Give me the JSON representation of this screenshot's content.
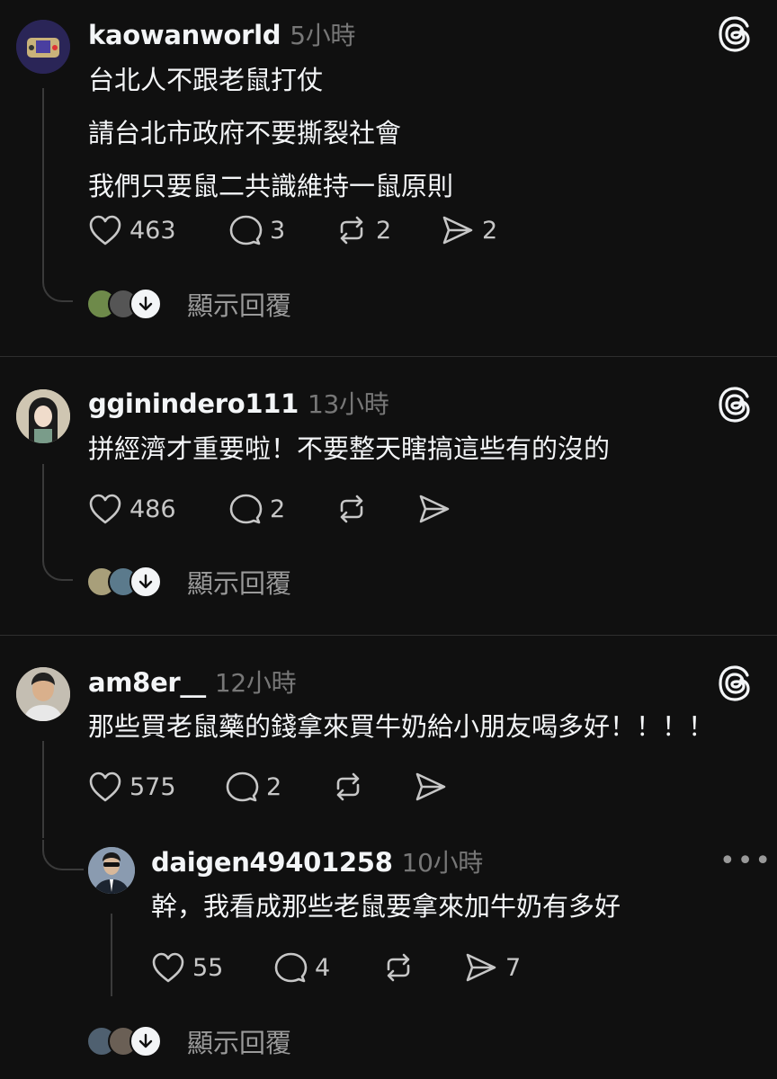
{
  "posts": [
    {
      "username": "kaowanworld",
      "time": "5小時",
      "lines": [
        "台北人不跟老鼠打仗",
        "請台北市政府不要撕裂社會",
        "我們只要鼠二共識維持一鼠原則"
      ],
      "likes": "463",
      "comments": "3",
      "reposts": "2",
      "shares": "2",
      "show_replies": "顯示回覆"
    },
    {
      "username": "gginindero111",
      "time": "13小時",
      "lines": [
        "拼經濟才重要啦！不要整天瞎搞這些有的沒的"
      ],
      "likes": "486",
      "comments": "2",
      "reposts": "",
      "shares": "",
      "show_replies": "顯示回覆"
    },
    {
      "username": "am8er__",
      "time": "12小時",
      "lines": [
        "那些買老鼠藥的錢拿來買牛奶給小朋友喝多好！！！！"
      ],
      "likes": "575",
      "comments": "2",
      "reposts": "",
      "shares": ""
    }
  ],
  "reply": {
    "username": "daigen49401258",
    "time": "10小時",
    "text": "幹，我看成那些老鼠要拿來加牛奶有多好",
    "likes": "55",
    "comments": "4",
    "reposts": "",
    "shares": "7",
    "more": "•••",
    "show_replies": "顯示回覆"
  },
  "colors": {
    "background": "#101010",
    "text": "#f3f5f7",
    "muted": "#777777",
    "separator": "#2e2e2e"
  }
}
